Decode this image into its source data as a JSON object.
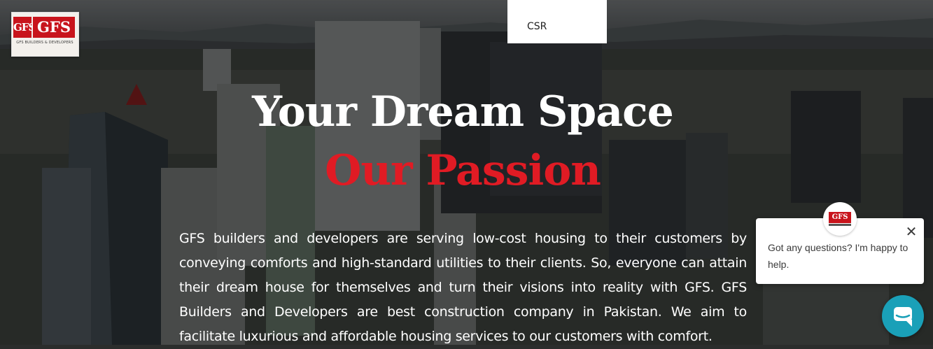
{
  "brand": {
    "logo_text": "GFS",
    "logo_mark": "GFS",
    "tagline": "GFS BUILDERS & DEVELOPERS"
  },
  "nav": {
    "dropdown_item": "CSR"
  },
  "hero": {
    "title_line1": "Your Dream Space",
    "title_line2": "Our Passion",
    "title_line2_color": "#e01b24",
    "description": "GFS builders and developers are serving low-cost housing to their customers by conveying comforts and high-standard utilities to their clients. So, everyone can attain their dream house for themselves and turn their visions into reality with GFS. GFS Builders and Developers are best construction company in Pakistan. We aim to facilitate luxurious and affordable housing services to our customers with comfort."
  },
  "chat": {
    "message": "Got any questions? I'm happy to help.",
    "close_icon": "close-icon",
    "launcher_icon": "chat-bubble-icon",
    "launcher_color": "#1aa0b8"
  }
}
